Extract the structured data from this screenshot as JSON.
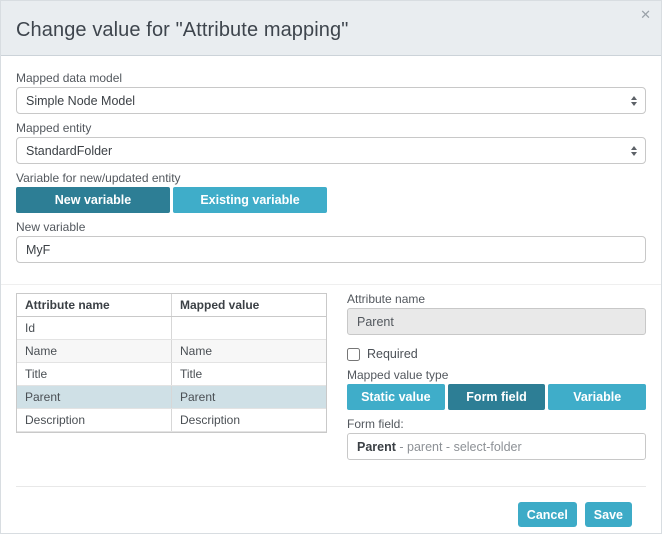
{
  "modal": {
    "title": "Change value for \"Attribute mapping\"",
    "close_icon": "✕"
  },
  "form": {
    "mapped_data_model": {
      "label": "Mapped data model",
      "value": "Simple Node Model"
    },
    "mapped_entity": {
      "label": "Mapped entity",
      "value": "StandardFolder"
    },
    "variable_section": {
      "label": "Variable for new/updated entity",
      "options": [
        {
          "label": "New variable",
          "selected": true
        },
        {
          "label": "Existing variable",
          "selected": false
        }
      ]
    },
    "new_variable": {
      "label": "New variable",
      "value": "MyF"
    }
  },
  "mapping_table": {
    "columns": [
      "Attribute name",
      "Mapped value"
    ],
    "rows": [
      {
        "attribute": "Id",
        "mapped": "",
        "selected": false
      },
      {
        "attribute": "Name",
        "mapped": "Name",
        "selected": false
      },
      {
        "attribute": "Title",
        "mapped": "Title",
        "selected": false
      },
      {
        "attribute": "Parent",
        "mapped": "Parent",
        "selected": true
      },
      {
        "attribute": "Description",
        "mapped": "Description",
        "selected": false
      }
    ]
  },
  "detail_panel": {
    "attribute_name": {
      "label": "Attribute name",
      "value": "Parent"
    },
    "required": {
      "label": "Required",
      "checked": false
    },
    "mapped_value_type": {
      "label": "Mapped value type",
      "options": [
        {
          "label": "Static value",
          "selected": false
        },
        {
          "label": "Form field",
          "selected": true
        },
        {
          "label": "Variable",
          "selected": false
        }
      ]
    },
    "form_field": {
      "label": "Form field:",
      "value_primary": "Parent",
      "value_secondary": " - parent - select-folder"
    }
  },
  "footer": {
    "cancel_label": "Cancel",
    "save_label": "Save"
  },
  "colors": {
    "teal": "#3dabc7",
    "teal_dark": "#2d7e95",
    "selected_row": "#cfe0e6",
    "header_bg": "#e9edf0"
  }
}
